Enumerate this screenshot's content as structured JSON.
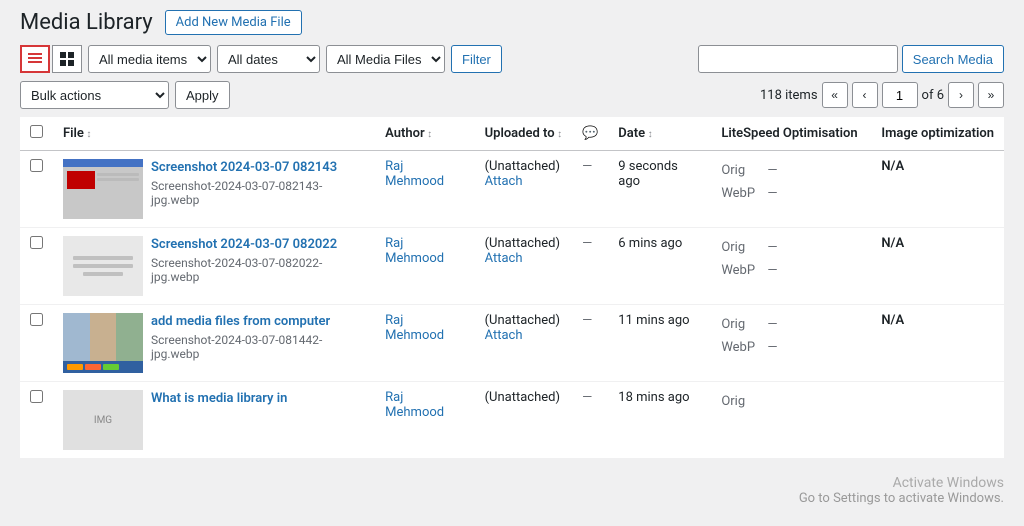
{
  "page": {
    "title": "Media Library",
    "add_new_label": "Add New Media File"
  },
  "toolbar": {
    "filter_options": [
      "All media items",
      "All dates",
      "All Media Files"
    ],
    "filter_label": "Filter",
    "search_placeholder": "",
    "search_label": "Search Media"
  },
  "bulk": {
    "actions_label": "Bulk actions",
    "apply_label": "Apply",
    "items_count": "118 items",
    "page_current": "1",
    "page_total": "of 6"
  },
  "table": {
    "columns": {
      "file": "File",
      "author": "Author",
      "uploaded_to": "Uploaded to",
      "comment": "💬",
      "date": "Date",
      "litespeed": "LiteSpeed Optimisation",
      "image_opt": "Image optimization"
    },
    "rows": [
      {
        "id": 1,
        "file_title": "Screenshot 2024-03-07 082143",
        "file_name": "Screenshot-2024-03-07-082143-jpg.webp",
        "author": "Raj Mehmood",
        "uploaded_to": "(Unattached)",
        "attach": "Attach",
        "comment": "—",
        "date": "9 seconds ago",
        "ls_orig": "—",
        "ls_webp": "—",
        "image_opt": "N/A",
        "thumb_type": "screenshot_red"
      },
      {
        "id": 2,
        "file_title": "Screenshot 2024-03-07 082022",
        "file_name": "Screenshot-2024-03-07-082022-jpg.webp",
        "author": "Raj Mehmood",
        "uploaded_to": "(Unattached)",
        "attach": "Attach",
        "comment": "—",
        "date": "6 mins ago",
        "ls_orig": "—",
        "ls_webp": "—",
        "image_opt": "N/A",
        "thumb_type": "screenshot_plain"
      },
      {
        "id": 3,
        "file_title": "add media files from computer",
        "file_name": "Screenshot-2024-03-07-081442-jpg.webp",
        "author": "Raj Mehmood",
        "uploaded_to": "(Unattached)",
        "attach": "Attach",
        "comment": "—",
        "date": "11 mins ago",
        "ls_orig": "—",
        "ls_webp": "—",
        "image_opt": "N/A",
        "thumb_type": "screenshot_mixed"
      },
      {
        "id": 4,
        "file_title": "What is media library in",
        "file_name": "",
        "author": "Raj Mehmood",
        "uploaded_to": "(Unattached)",
        "attach": "",
        "comment": "—",
        "date": "18 mins ago",
        "ls_orig": "",
        "ls_webp": "",
        "image_opt": "",
        "thumb_type": "what"
      }
    ],
    "orig_label": "Orig",
    "webp_label": "WebP"
  },
  "activate_windows": {
    "line1": "Activate Windows",
    "line2": "Go to Settings to activate Windows."
  }
}
